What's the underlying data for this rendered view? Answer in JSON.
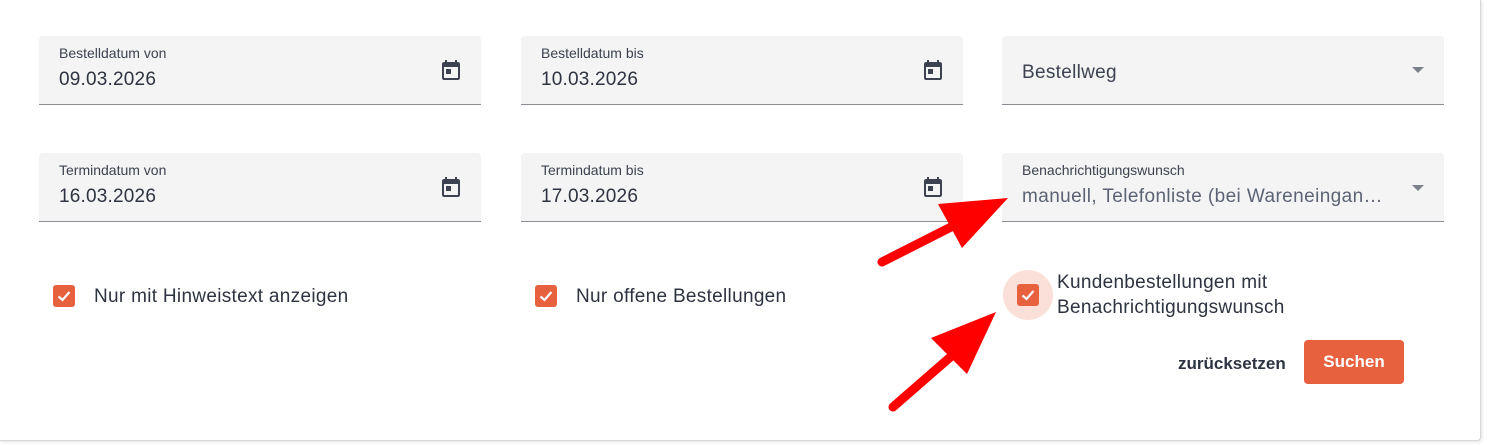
{
  "filters": {
    "order_date_from": {
      "label": "Bestelldatum von",
      "value": "09.03.2026",
      "icon": "calendar-icon"
    },
    "order_date_to": {
      "label": "Bestelldatum bis",
      "value": "10.03.2026",
      "icon": "calendar-icon"
    },
    "order_channel": {
      "placeholder": "Bestellweg",
      "icon": "dropdown-arrow-icon"
    },
    "appointment_date_from": {
      "label": "Termindatum von",
      "value": "16.03.2026",
      "icon": "calendar-icon"
    },
    "appointment_date_to": {
      "label": "Termindatum bis",
      "value": "17.03.2026",
      "icon": "calendar-icon"
    },
    "notification_preference": {
      "label": "Benachrichtigungswunsch",
      "value": "manuell, Telefonliste (bei Wareneingan…",
      "icon": "dropdown-arrow-icon"
    }
  },
  "checkboxes": {
    "only_with_note": {
      "label": "Nur mit Hinweistext anzeigen",
      "checked": true
    },
    "only_open_orders": {
      "label": "Nur offene Bestellungen",
      "checked": true
    },
    "customer_orders_with_notification": {
      "label_line1": "Kundenbestellungen mit",
      "label_line2": "Benachrichtigungswunsch",
      "checked": true
    }
  },
  "actions": {
    "reset_label": "zurücksetzen",
    "search_label": "Suchen"
  },
  "colors": {
    "accent": "#e8613f",
    "field_background": "#f4f4f5",
    "text": "#2d3340",
    "annotation_arrow": "#ff0000"
  }
}
